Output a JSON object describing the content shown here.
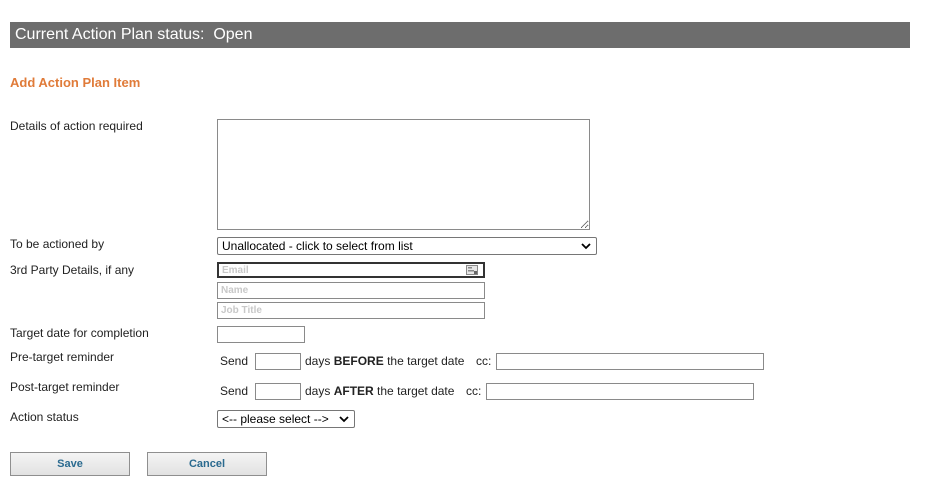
{
  "status_bar": {
    "label": "Current Action Plan status:",
    "value": "Open"
  },
  "section_title": "Add Action Plan Item",
  "form": {
    "details": {
      "label": "Details of action required",
      "value": ""
    },
    "actioned_by": {
      "label": "To be actioned by",
      "selected": "Unallocated - click to select from list"
    },
    "third_party": {
      "label": "3rd Party Details, if any",
      "email_placeholder": "Email",
      "name_placeholder": "Name",
      "job_title_placeholder": "Job Title"
    },
    "target_date": {
      "label": "Target date for completion",
      "value": ""
    },
    "pre_reminder": {
      "label": "Pre-target reminder",
      "send": "Send",
      "days_text": "days",
      "emph": "BEFORE",
      "suffix": "the target date",
      "cc": "cc:"
    },
    "post_reminder": {
      "label": "Post-target reminder",
      "send": "Send",
      "days_text": "days",
      "emph": "AFTER",
      "suffix": "the target date",
      "cc": "cc:"
    },
    "action_status": {
      "label": "Action status",
      "selected": "<-- please select -->"
    }
  },
  "buttons": {
    "save": "Save",
    "cancel": "Cancel"
  },
  "colors": {
    "status_bar_bg": "#6d6d6d",
    "section_title": "#e07b39",
    "button_text": "#2a6a8f"
  }
}
